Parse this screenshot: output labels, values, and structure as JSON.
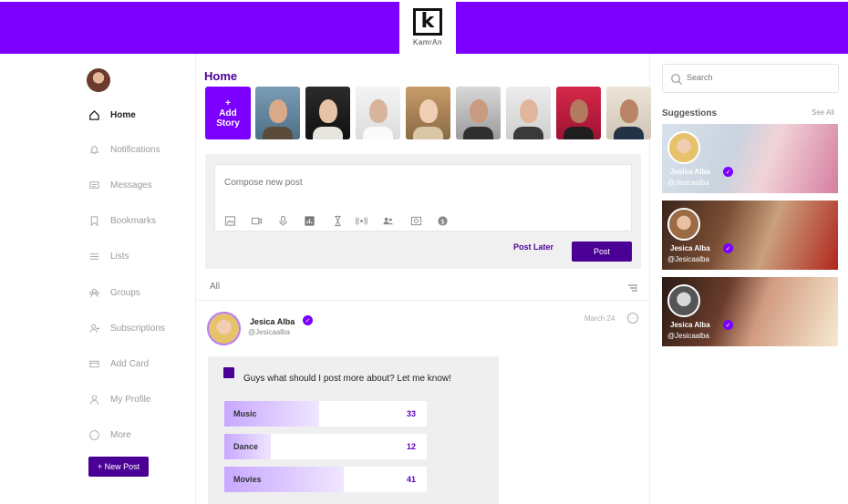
{
  "brand": {
    "logo_letter": "k",
    "logo_text": "KamrAn"
  },
  "sidebar": {
    "items": [
      {
        "label": "Home",
        "icon": "home-icon",
        "active": true
      },
      {
        "label": "Notifications",
        "icon": "bell-icon"
      },
      {
        "label": "Messages",
        "icon": "messages-icon"
      },
      {
        "label": "Bookmarks",
        "icon": "bookmark-icon"
      },
      {
        "label": "Lists",
        "icon": "list-icon"
      },
      {
        "label": "Groups",
        "icon": "groups-icon"
      },
      {
        "label": "Subscriptions",
        "icon": "subscriptions-icon"
      },
      {
        "label": "Add Card",
        "icon": "card-icon"
      },
      {
        "label": "My Profile",
        "icon": "profile-icon"
      },
      {
        "label": "More",
        "icon": "more-icon"
      }
    ],
    "new_post": "+ New Post"
  },
  "main": {
    "title": "Home",
    "add_story": {
      "plus": "+",
      "line1": "Add",
      "line2": "Story"
    },
    "stories_count": 9,
    "composer": {
      "placeholder": "Compose new post",
      "post_later": "Post Later",
      "post": "Post",
      "tools": [
        "image-icon",
        "video-icon",
        "microphone-icon",
        "poll-icon",
        "hourglass-icon",
        "live-icon",
        "people-icon",
        "camera-icon",
        "dollar-icon"
      ]
    },
    "filter": {
      "label": "All"
    },
    "post": {
      "name": "Jesica Alba",
      "handle": "@Jesicaalba",
      "date": "March 24",
      "poll": {
        "question": "Guys what should I post more about? Let me know!",
        "options": [
          {
            "label": "Music",
            "count": "33",
            "fill": 0.47
          },
          {
            "label": "Dance",
            "count": "12",
            "fill": 0.23
          },
          {
            "label": "Movies",
            "count": "41",
            "fill": 0.59
          }
        ]
      }
    }
  },
  "right": {
    "search_placeholder": "Search",
    "suggestions_title": "Suggestions",
    "see_all": "See All",
    "cards": [
      {
        "name": "Jesica Alba",
        "handle": "@Jesicaalba"
      },
      {
        "name": "Jesica Alba",
        "handle": "@Jesicaalba"
      },
      {
        "name": "Jesica Alba",
        "handle": "@Jesicaalba"
      }
    ]
  },
  "colors": {
    "brand": "#7b00ff",
    "brand_dark": "#4b0095"
  }
}
